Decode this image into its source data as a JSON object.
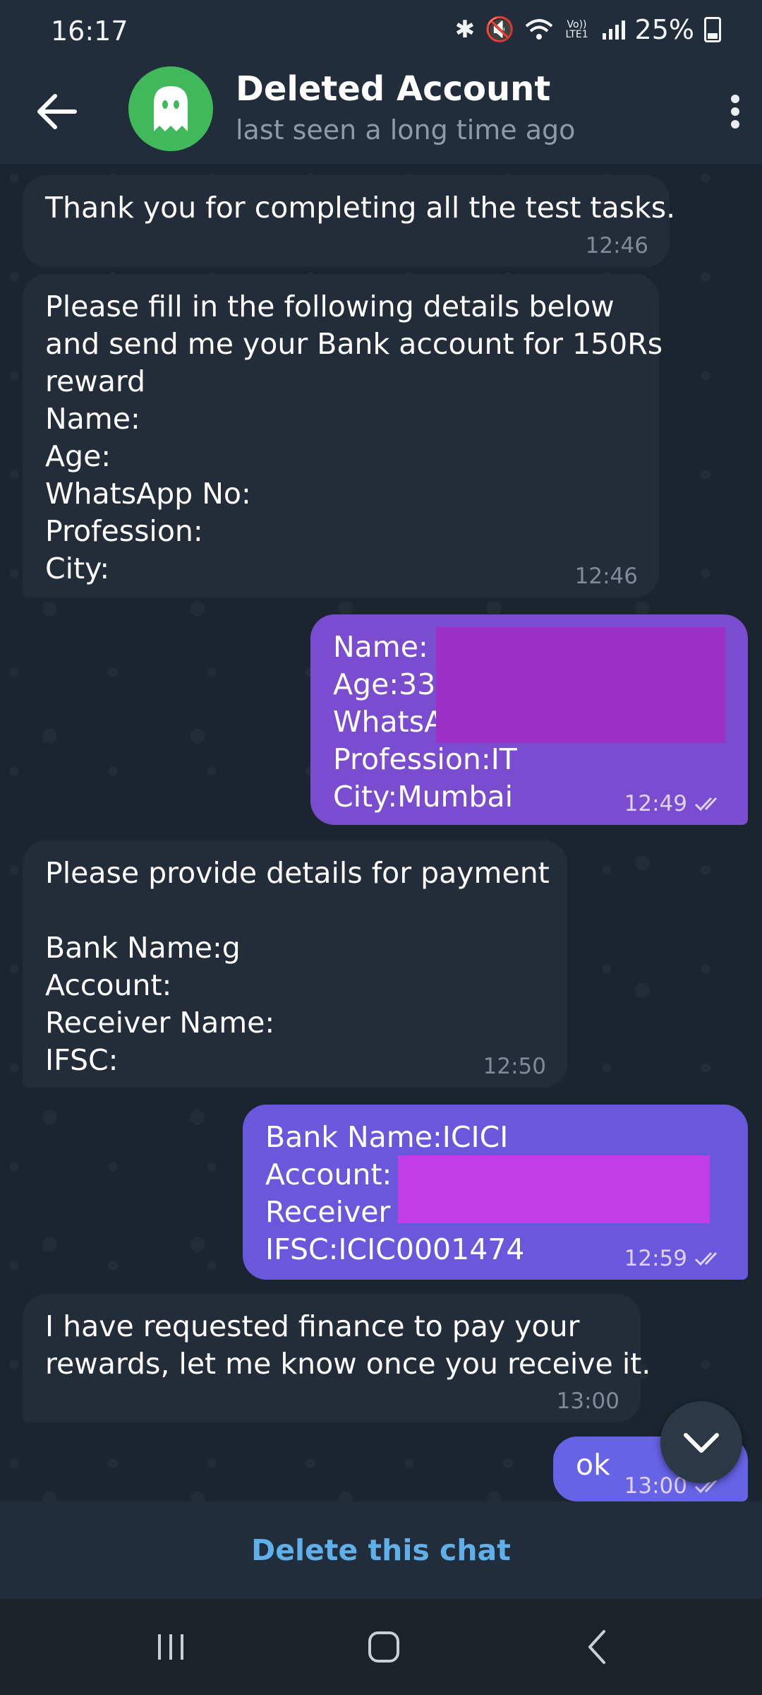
{
  "status_bar": {
    "time": "16:17",
    "battery": "25%",
    "icons": [
      "bluetooth-icon",
      "mute-icon",
      "wifi-icon",
      "volte-icon",
      "signal-icon",
      "battery-charging-icon"
    ],
    "volte_label": "Vo)) LTE1"
  },
  "header": {
    "title": "Deleted Account",
    "subtitle": "last seen a long time ago",
    "avatar_icon": "ghost-icon",
    "avatar_color": "#3fb95a"
  },
  "messages": [
    {
      "direction": "in",
      "lines": [
        "Thank you for completing all the test tasks."
      ],
      "time": "12:46"
    },
    {
      "direction": "in",
      "lines": [
        "Please fill in the following details below",
        "and send me your Bank account for 150Rs",
        "reward",
        "Name:",
        "Age:",
        "WhatsApp No:",
        "Profession:",
        "City:"
      ],
      "time": "12:46"
    },
    {
      "direction": "out",
      "lines": [
        "Name: A",
        "Age:33",
        "WhatsA",
        "Profession:IT",
        "City:Mumbai"
      ],
      "time": "12:49",
      "status": "read"
    },
    {
      "direction": "in",
      "lines": [
        "Please provide details for payment",
        "",
        "Bank Name:g",
        "Account:",
        "Receiver Name:",
        "IFSC:"
      ],
      "time": "12:50"
    },
    {
      "direction": "out",
      "lines": [
        "Bank Name:ICICI",
        "Account:",
        "Receiver N",
        "IFSC:ICIC0001474"
      ],
      "time": "12:59",
      "status": "read"
    },
    {
      "direction": "in",
      "lines": [
        "I have requested finance to pay your",
        "rewards, let me know once you receive it."
      ],
      "time": "13:00"
    },
    {
      "direction": "out",
      "lines": [
        "ok"
      ],
      "time": "13:00",
      "status": "read"
    }
  ],
  "bottom": {
    "delete_label": "Delete this chat"
  },
  "colors": {
    "incoming_bubble": "#222d39",
    "outgoing_bubble": "#7a4ccf",
    "link_blue": "#5fb0ea",
    "redaction_purple": "#9b2fc6",
    "redaction_magenta": "#c43ee8"
  },
  "nav": {
    "buttons": [
      "recent-apps-icon",
      "home-icon",
      "back-icon"
    ]
  }
}
